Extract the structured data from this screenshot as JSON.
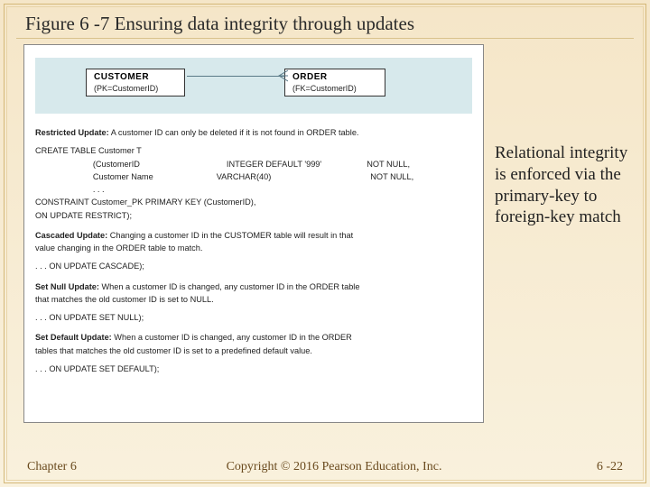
{
  "title": "Figure 6 -7 Ensuring data integrity through updates",
  "er": {
    "e1": {
      "name": "CUSTOMER",
      "key": "(PK=CustomerID)"
    },
    "e2": {
      "name": "ORDER",
      "key": "(FK=CustomerID)"
    }
  },
  "code": {
    "restricted_label": "Restricted Update:",
    "restricted_text": " A customer ID can only be deleted if it is not found in ORDER table.",
    "create": "CREATE TABLE Customer T",
    "col1a": "                         (CustomerID",
    "col1b": "INTEGER DEFAULT '999'",
    "col1c": "NOT NULL,",
    "col2a": "                         Customer Name",
    "col2b": "VARCHAR(40)",
    "col2c": "NOT NULL,",
    "dots1": "                         . . .",
    "constraint": "CONSTRAINT Customer_PK PRIMARY KEY (CustomerID),",
    "on_restrict": "ON UPDATE RESTRICT);",
    "cascaded_label": "Cascaded Update:",
    "cascaded_text": " Changing a customer ID in the CUSTOMER table will result in that",
    "cascaded_text2": "value changing in the ORDER table to match.",
    "on_cascade": ". . . ON UPDATE CASCADE);",
    "setnull_label": "Set Null Update:",
    "setnull_text": " When a customer ID is changed, any customer ID in the ORDER table",
    "setnull_text2": "that matches the old customer ID is set to NULL.",
    "on_setnull": ". . . ON UPDATE SET NULL);",
    "setdefault_label": "Set Default Update:",
    "setdefault_text": " When a customer ID is changed, any customer ID in the ORDER",
    "setdefault_text2": "tables that matches the old customer ID is set to a predefined default value.",
    "on_setdefault": ". . . ON UPDATE SET DEFAULT);"
  },
  "callout": "Relational integrity is enforced via the primary-key to foreign-key match",
  "footer": {
    "chapter": "Chapter 6",
    "copyright": "Copyright © 2016 Pearson Education, Inc.",
    "page": "6 -22"
  }
}
